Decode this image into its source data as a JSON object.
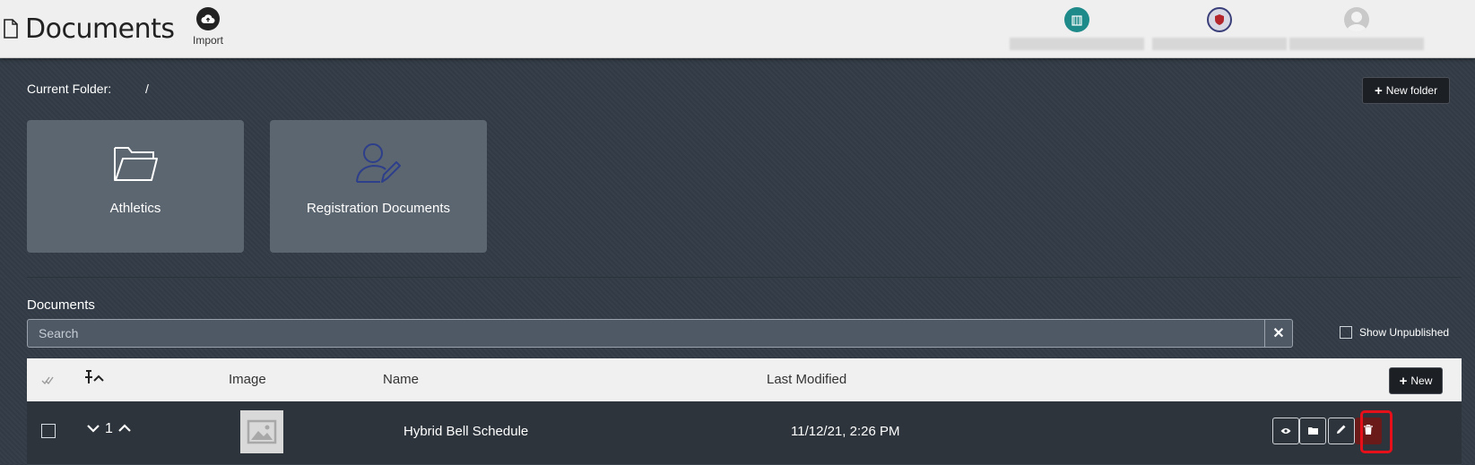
{
  "header": {
    "title": "Documents",
    "title_icon": "document-icon",
    "import_label": "Import",
    "import_icon": "cloud-upload-icon"
  },
  "folder_bar": {
    "label": "Current Folder:",
    "path": "/",
    "new_folder_label": "New folder"
  },
  "folders": [
    {
      "label": "Athletics",
      "icon": "folder-icon"
    },
    {
      "label": "Registration Documents",
      "icon": "user-edit-icon"
    }
  ],
  "documents": {
    "section_title": "Documents",
    "search_placeholder": "Search",
    "show_unpublished_label": "Show Unpublished",
    "columns": {
      "image": "Image",
      "name": "Name",
      "last_modified": "Last Modified"
    },
    "new_label": "New",
    "rows": [
      {
        "order": "1",
        "name": "Hybrid Bell Schedule",
        "last_modified": "11/12/21, 2:26 PM"
      }
    ]
  },
  "colors": {
    "background": "#333c46",
    "folder_card": "#5c6670",
    "delete_button": "#6b1a1a",
    "highlight": "#e5101a"
  }
}
